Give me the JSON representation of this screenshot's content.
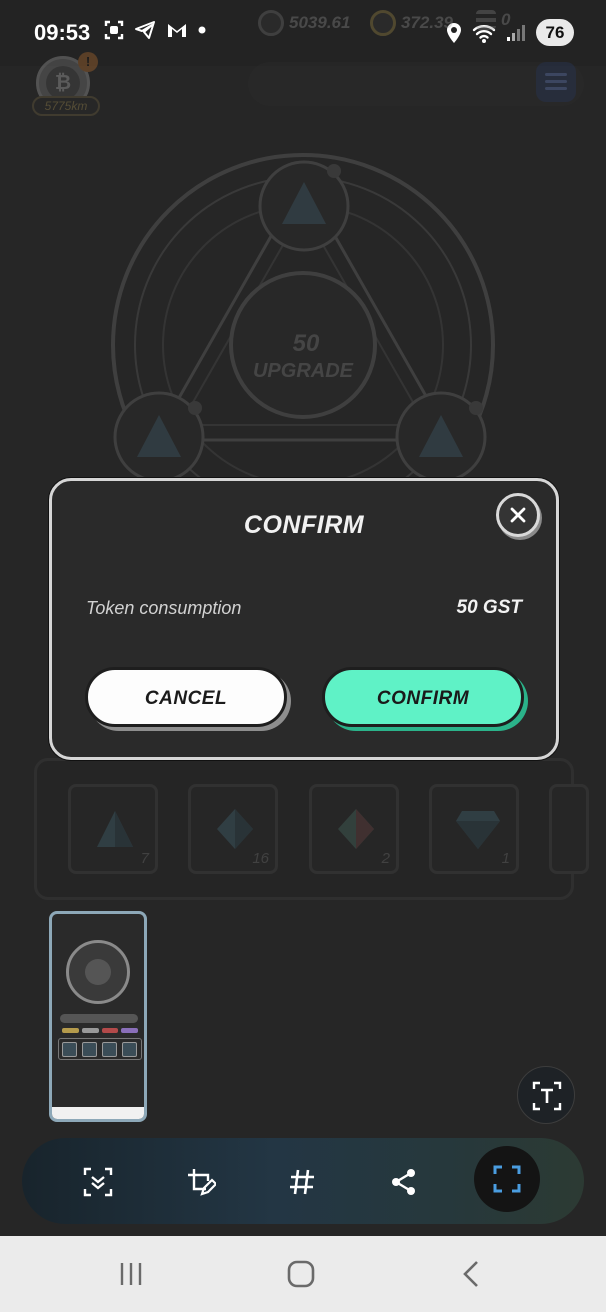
{
  "status_bar": {
    "time": "09:53",
    "battery": "76",
    "left_icons": [
      "screenshot-icon",
      "telegram-icon",
      "gmail-icon",
      "dot-icon"
    ],
    "right_icons": [
      "location-icon",
      "wifi-icon",
      "signal-icon"
    ]
  },
  "header": {
    "distance": "5775km",
    "balances": [
      {
        "icon": "gst-coin-icon",
        "value": "5039.61"
      },
      {
        "icon": "gmt-coin-icon",
        "value": "372.39"
      },
      {
        "icon": "stack-icon",
        "value": "0"
      }
    ]
  },
  "upgrade": {
    "cost": "50",
    "label": "UPGRADE"
  },
  "inventory": {
    "slots": [
      {
        "count": "7",
        "icon": "pyramid-gem-icon"
      },
      {
        "count": "16",
        "icon": "octahedron-gem-icon"
      },
      {
        "count": "2",
        "icon": "octahedron-gem-icon"
      },
      {
        "count": "1",
        "icon": "diamond-gem-icon"
      }
    ]
  },
  "dialog": {
    "title": "CONFIRM",
    "row_label": "Token consumption",
    "row_value": "50 GST",
    "cancel_label": "CANCEL",
    "confirm_label": "CONFIRM"
  },
  "capture_toolbar": {
    "tools": [
      "scroll-capture-icon",
      "edit-icon",
      "hashtag-icon",
      "share-icon",
      "scan-icon"
    ]
  },
  "colors": {
    "confirm_accent": "#5FF2C6",
    "dialog_bg": "#2A2A2A",
    "page_bg": "#232323"
  }
}
